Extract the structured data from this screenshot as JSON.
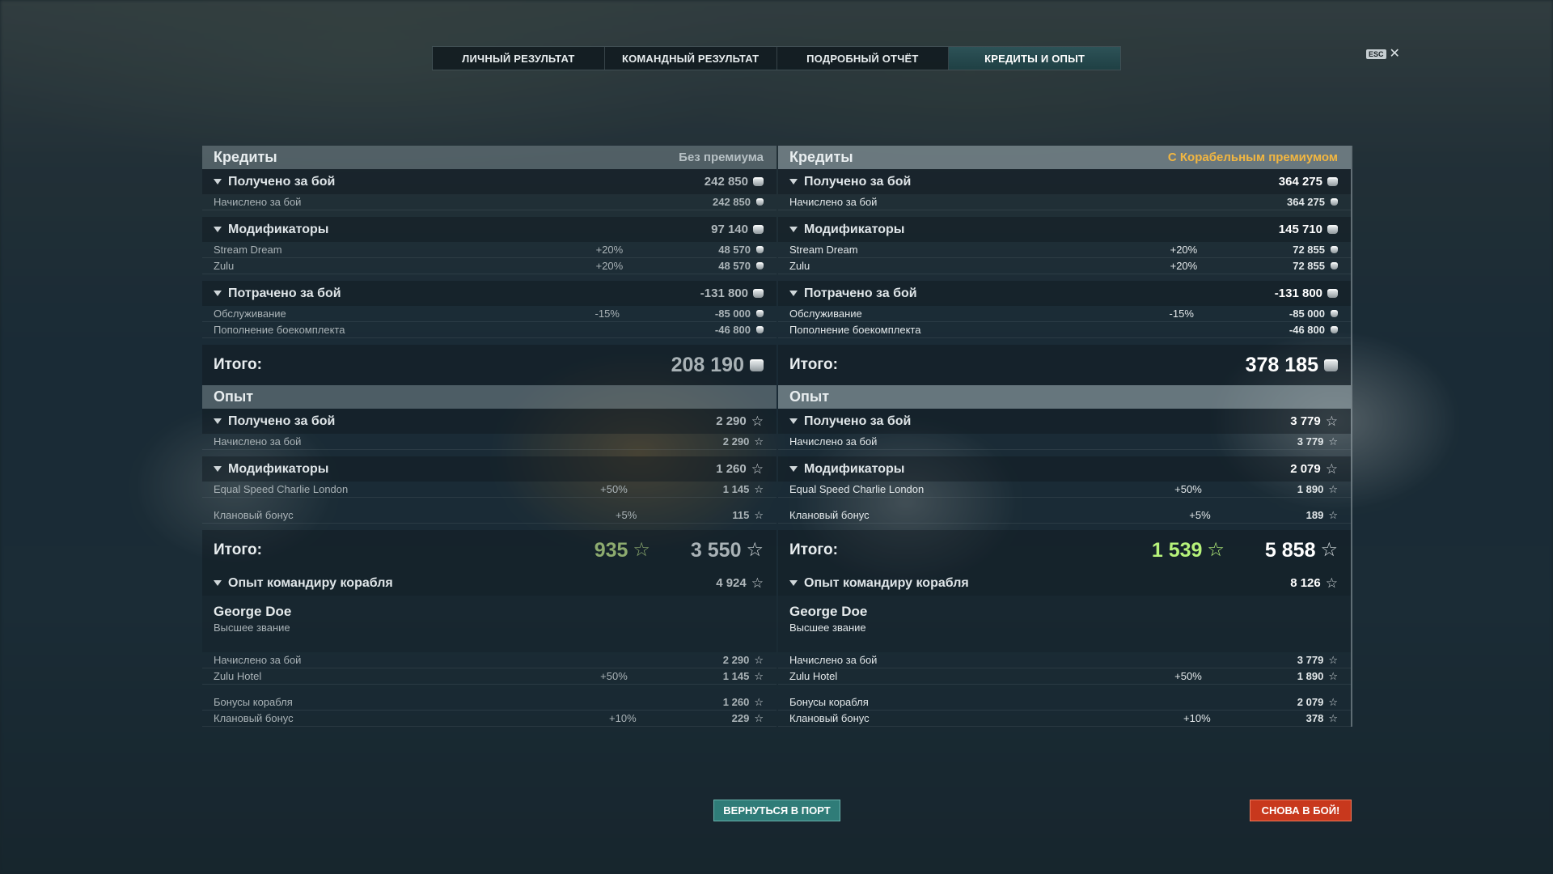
{
  "tabs": [
    {
      "label": "ЛИЧНЫЙ РЕЗУЛЬТАТ",
      "active": false
    },
    {
      "label": "КОМАНДНЫЙ РЕЗУЛЬТАТ",
      "active": false
    },
    {
      "label": "ПОДРОБНЫЙ ОТЧЁТ",
      "active": false
    },
    {
      "label": "КРЕДИТЫ И ОПЫТ",
      "active": true
    }
  ],
  "esc_label": "ESC",
  "colors": {
    "accent_teal": "#2f7c78",
    "premium_gold": "#f2b640",
    "battle_red": "#c8381d",
    "xp_green": "#b6f27a"
  },
  "left": {
    "credits_title": "Кредиты",
    "credits_sub": "Без премиума",
    "earned": {
      "label": "Получено за бой",
      "value": "242 850",
      "rows": [
        {
          "label": "Начислено за бой",
          "pct": "",
          "value": "242 850"
        }
      ]
    },
    "modifiers": {
      "label": "Модификаторы",
      "value": "97 140",
      "rows": [
        {
          "label": "Stream Dream",
          "pct": "+20%",
          "value": "48 570"
        },
        {
          "label": "Zulu",
          "pct": "+20%",
          "value": "48 570"
        }
      ]
    },
    "spent": {
      "label": "Потрачено за бой",
      "value": "-131 800",
      "rows": [
        {
          "label": "Обслуживание",
          "pct": "-15%",
          "value": "-85 000"
        },
        {
          "label": "Пополнение боекомплекта",
          "pct": "",
          "value": "-46 800"
        }
      ]
    },
    "credits_total_label": "Итого:",
    "credits_total": "208 190",
    "xp_title": "Опыт",
    "xp_earned": {
      "label": "Получено за бой",
      "value": "2 290",
      "rows": [
        {
          "label": "Начислено за бой",
          "pct": "",
          "value": "2 290"
        }
      ]
    },
    "xp_modifiers": {
      "label": "Модификаторы",
      "value": "1 260",
      "rows": [
        {
          "label": "Equal Speed Charlie London",
          "pct": "+50%",
          "value": "1 145"
        },
        {
          "label": "Клановый бонус",
          "pct": "+5%",
          "value": "115"
        }
      ]
    },
    "xp_total_label": "Итого:",
    "xp_total_free": "935",
    "xp_total": "3 550",
    "commander": {
      "label": "Опыт командиру корабля",
      "value": "4 924",
      "name": "George Doe",
      "rank": "Высшее звание",
      "rows": [
        {
          "label": "Начислено за бой",
          "pct": "",
          "value": "2 290"
        },
        {
          "label": "Zulu Hotel",
          "pct": "+50%",
          "value": "1 145"
        },
        {
          "label": "Бонусы корабля",
          "pct": "",
          "value": "1 260"
        },
        {
          "label": "Клановый бонус",
          "pct": "+10%",
          "value": "229"
        }
      ]
    }
  },
  "right": {
    "credits_title": "Кредиты",
    "credits_sub": "С Корабельным премиумом",
    "earned": {
      "label": "Получено за бой",
      "value": "364 275",
      "rows": [
        {
          "label": "Начислено за бой",
          "pct": "",
          "value": "364 275"
        }
      ]
    },
    "modifiers": {
      "label": "Модификаторы",
      "value": "145 710",
      "rows": [
        {
          "label": "Stream Dream",
          "pct": "+20%",
          "value": "72 855"
        },
        {
          "label": "Zulu",
          "pct": "+20%",
          "value": "72 855"
        }
      ]
    },
    "spent": {
      "label": "Потрачено за бой",
      "value": "-131 800",
      "rows": [
        {
          "label": "Обслуживание",
          "pct": "-15%",
          "value": "-85 000"
        },
        {
          "label": "Пополнение боекомплекта",
          "pct": "",
          "value": "-46 800"
        }
      ]
    },
    "credits_total_label": "Итого:",
    "credits_total": "378 185",
    "xp_title": "Опыт",
    "xp_earned": {
      "label": "Получено за бой",
      "value": "3 779",
      "rows": [
        {
          "label": "Начислено за бой",
          "pct": "",
          "value": "3 779"
        }
      ]
    },
    "xp_modifiers": {
      "label": "Модификаторы",
      "value": "2 079",
      "rows": [
        {
          "label": "Equal Speed Charlie London",
          "pct": "+50%",
          "value": "1 890"
        },
        {
          "label": "Клановый бонус",
          "pct": "+5%",
          "value": "189"
        }
      ]
    },
    "xp_total_label": "Итого:",
    "xp_total_free": "1 539",
    "xp_total": "5 858",
    "commander": {
      "label": "Опыт командиру корабля",
      "value": "8 126",
      "name": "George Doe",
      "rank": "Высшее звание",
      "rows": [
        {
          "label": "Начислено за бой",
          "pct": "",
          "value": "3 779"
        },
        {
          "label": "Zulu Hotel",
          "pct": "+50%",
          "value": "1 890"
        },
        {
          "label": "Бонусы корабля",
          "pct": "",
          "value": "2 079"
        },
        {
          "label": "Клановый бонус",
          "pct": "+10%",
          "value": "378"
        }
      ]
    }
  },
  "buttons": {
    "port": "ВЕРНУТЬСЯ В ПОРТ",
    "battle": "СНОВА В БОЙ!"
  }
}
